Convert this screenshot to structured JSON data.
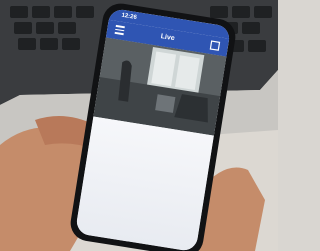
{
  "phone": {
    "status_time": "12:26",
    "app_title": "Live"
  },
  "colors": {
    "app_header": "#2f55b3",
    "background": "#d9d6d1",
    "laptop": "#3a3c3f",
    "skin": "#c58c6a"
  },
  "icons": [
    "menu-icon",
    "back-icon"
  ]
}
